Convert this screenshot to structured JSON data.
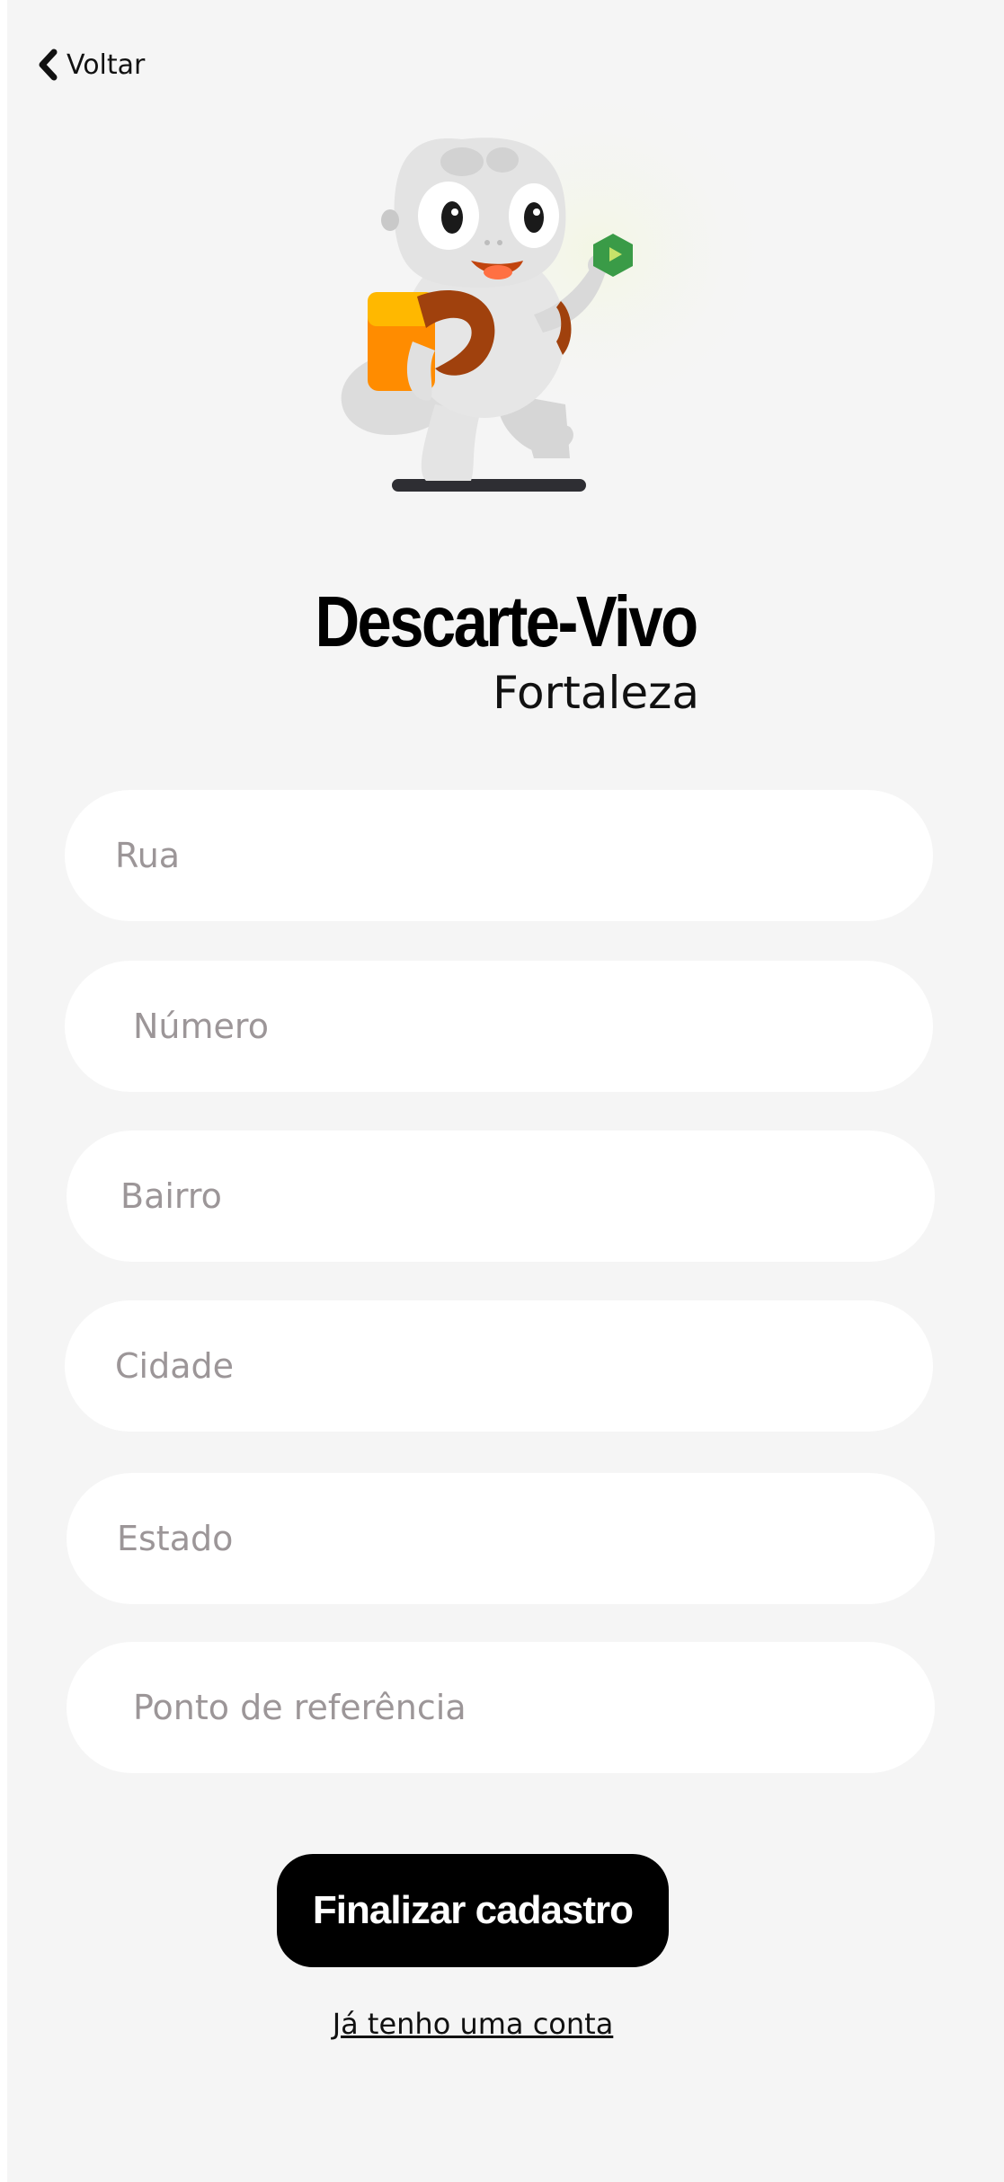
{
  "nav": {
    "back_label": "Voltar",
    "back_icon": "chevron-left-icon"
  },
  "brand": {
    "title": "Descarte-Vivo",
    "subtitle": "Fortaleza",
    "mascot": "frog-mascot-with-backpack"
  },
  "form": {
    "fields": [
      {
        "placeholder": "Rua",
        "value": ""
      },
      {
        "placeholder": "Número",
        "value": ""
      },
      {
        "placeholder": "Bairro",
        "value": ""
      },
      {
        "placeholder": "Cidade",
        "value": ""
      },
      {
        "placeholder": "Estado",
        "value": ""
      },
      {
        "placeholder": "Ponto de referência",
        "value": ""
      }
    ],
    "submit_label": "Finalizar cadastro",
    "login_link": "Já tenho uma conta"
  },
  "colors": {
    "background": "#f5f5f5",
    "field_background": "#ffffff",
    "placeholder": "#9c9698",
    "button": "#000000",
    "button_text": "#ffffff",
    "accent_orange": "#ff8c00",
    "accent_brown": "#a0410d",
    "accent_green": "#3a9b47"
  }
}
